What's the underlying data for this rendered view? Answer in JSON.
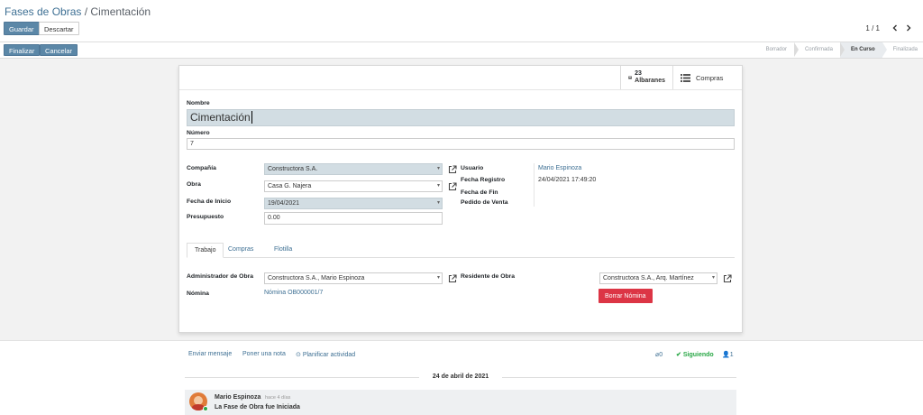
{
  "breadcrumb": {
    "parent": "Fases de Obras",
    "sep": "/",
    "current": "Cimentación"
  },
  "toolbar": {
    "save": "Guardar",
    "discard": "Descartar",
    "pager": "1 / 1"
  },
  "actions": {
    "finish": "Finalizar",
    "cancel": "Cancelar"
  },
  "statusbar": [
    "Borrador",
    "Confirmada",
    "En Curso",
    "Finalizada"
  ],
  "smart": {
    "albaranes_count": "23",
    "albaranes_label": "Albaranes",
    "compras": "Compras"
  },
  "form": {
    "nombre_label": "Nombre",
    "nombre": "Cimentación",
    "numero_label": "Número",
    "numero": "7",
    "compania_label": "Compañía",
    "compania": "Constructora S.A.",
    "obra_label": "Obra",
    "obra": "Casa G. Najera",
    "fecha_inicio_label": "Fecha de Inicio",
    "fecha_inicio": "19/04/2021",
    "presupuesto_label": "Presupuesto",
    "presupuesto": "0.00",
    "usuario_label": "Usuario",
    "usuario": "Mario Espinoza",
    "fecha_registro_label": "Fecha Registro",
    "fecha_registro": "24/04/2021 17:49:20",
    "fecha_fin_label": "Fecha de Fin",
    "pedido_label": "Pedido de Venta"
  },
  "tabs": [
    "Trabajo",
    "Compras",
    "Flotilla"
  ],
  "trabajo": {
    "admin_label": "Administrador de Obra",
    "admin": "Constructora S.A., Mario Espinoza",
    "residente_label": "Residente de Obra",
    "residente": "Constructora S.A., Arq. Martínez",
    "nomina_label": "Nómina",
    "nomina": "Nómina OB000001/7",
    "borrar": "Borrar Nómina"
  },
  "chatter": {
    "send": "Enviar mensaje",
    "note": "Poner una nota",
    "plan": "Planificar actividad",
    "attachments": "0",
    "following": "Siguiendo",
    "followers": "1",
    "date": "24 de abril de 2021",
    "author": "Mario Espinoza",
    "time": "hace 4 días",
    "body": "La Fase de Obra fue Iniciada"
  },
  "colors": {
    "primary": "#5b87a7",
    "link": "#3d6f93",
    "danger": "#dc3545",
    "success": "#28a745"
  }
}
